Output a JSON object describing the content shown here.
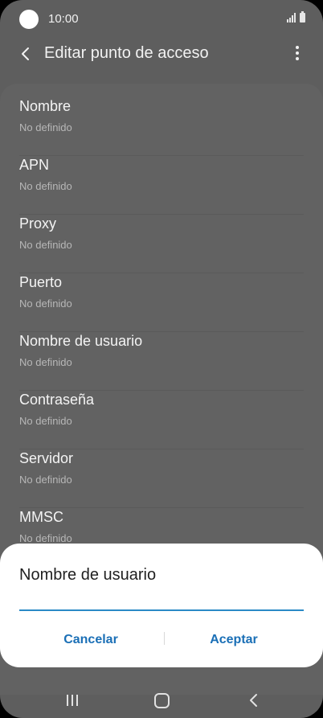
{
  "status_bar": {
    "time": "10:00"
  },
  "app_bar": {
    "title": "Editar punto de acceso"
  },
  "settings": [
    {
      "label": "Nombre",
      "value": "No definido"
    },
    {
      "label": "APN",
      "value": "No definido"
    },
    {
      "label": "Proxy",
      "value": "No definido"
    },
    {
      "label": "Puerto",
      "value": "No definido"
    },
    {
      "label": "Nombre de usuario",
      "value": "No definido"
    },
    {
      "label": "Contraseña",
      "value": "No definido"
    },
    {
      "label": "Servidor",
      "value": "No definido"
    },
    {
      "label": "MMSC",
      "value": "No definido"
    }
  ],
  "dialog": {
    "title": "Nombre de usuario",
    "input_value": "",
    "cancel_label": "Cancelar",
    "accept_label": "Aceptar"
  },
  "colors": {
    "accent": "#1a6fb6",
    "input_underline": "#2a8ac6",
    "dimmed_background": "#5e5e5e"
  }
}
